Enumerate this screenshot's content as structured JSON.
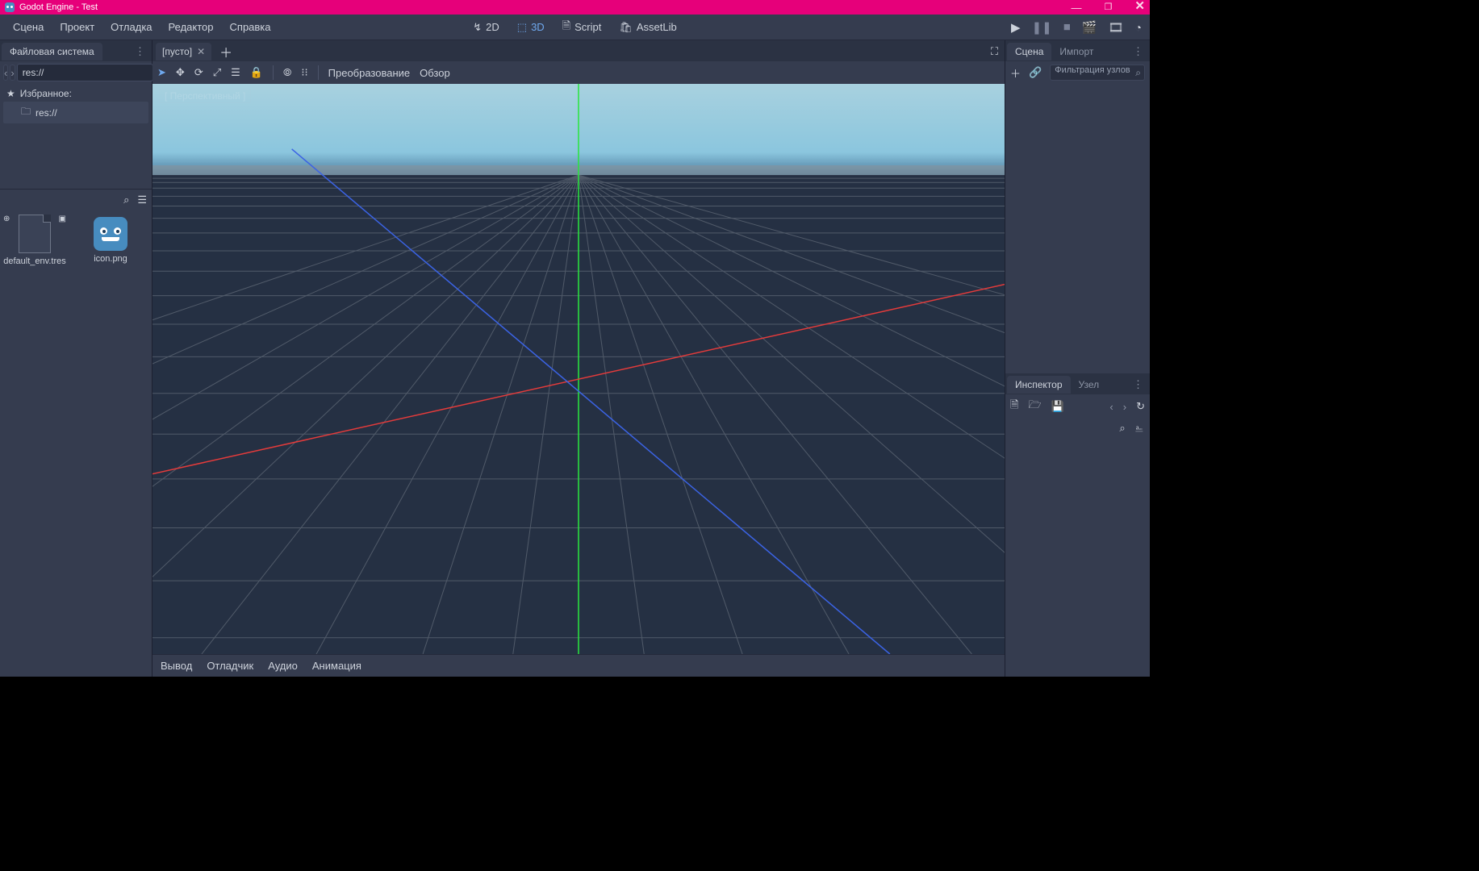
{
  "window": {
    "title": "Godot Engine - Test"
  },
  "menubar": {
    "items": [
      "Сцена",
      "Проект",
      "Отладка",
      "Редактор",
      "Справка"
    ]
  },
  "modes": {
    "btn_2d": "2D",
    "btn_3d": "3D",
    "btn_script": "Script",
    "btn_assetlib": "AssetLib"
  },
  "filesystem": {
    "tab": "Файловая система",
    "path": "res://",
    "favorites_label": "Избранное:",
    "root_label": "res://",
    "file_default_env": "default_env.tres",
    "file_icon": "icon.png"
  },
  "scene_tabs": {
    "empty_tab": "[пусто]"
  },
  "viewport": {
    "toolbar": {
      "transform": "Преобразование",
      "view": "Обзор"
    },
    "perspective_label": "[ Перспективный ]"
  },
  "bottom": {
    "output": "Вывод",
    "debugger": "Отладчик",
    "audio": "Аудио",
    "animation": "Анимация"
  },
  "scene_dock": {
    "tab_scene": "Сцена",
    "tab_import": "Импорт",
    "filter_placeholder": "Фильтрация узлов"
  },
  "inspector": {
    "tab_inspector": "Инспектор",
    "tab_node": "Узел"
  }
}
